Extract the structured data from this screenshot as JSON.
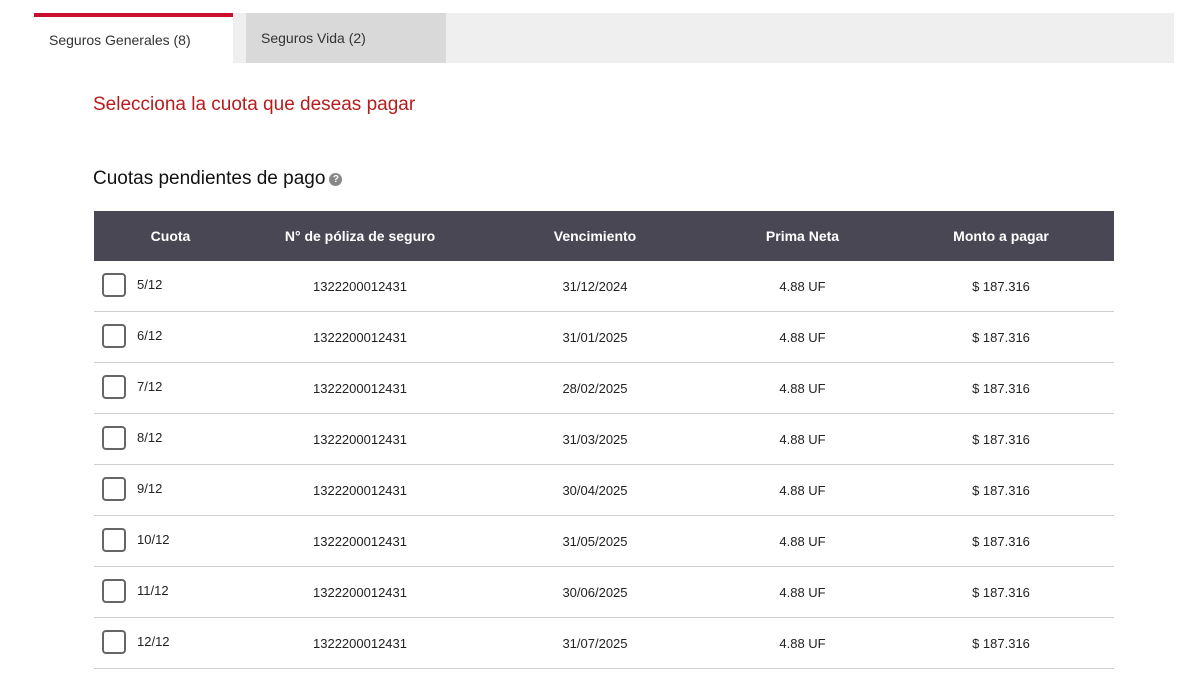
{
  "tabs": [
    {
      "label": "Seguros Generales (8)",
      "active": true
    },
    {
      "label": "Seguros Vida (2)",
      "active": false
    }
  ],
  "accent_color": "#c8102e",
  "section_title": "Selecciona la cuota que deseas pagar",
  "subtitle": "Cuotas pendientes de pago",
  "help_icon": "question-circle-icon",
  "table": {
    "headers": [
      "Cuota",
      "N° de póliza de seguro",
      "Vencimiento",
      "Prima Neta",
      "Monto a pagar"
    ],
    "rows": [
      {
        "cuota": "5/12",
        "poliza": "1322200012431",
        "vencimiento": "31/12/2024",
        "prima": "4.88 UF",
        "monto": "$ 187.316",
        "checked": false
      },
      {
        "cuota": "6/12",
        "poliza": "1322200012431",
        "vencimiento": "31/01/2025",
        "prima": "4.88 UF",
        "monto": "$ 187.316",
        "checked": false
      },
      {
        "cuota": "7/12",
        "poliza": "1322200012431",
        "vencimiento": "28/02/2025",
        "prima": "4.88 UF",
        "monto": "$ 187.316",
        "checked": false
      },
      {
        "cuota": "8/12",
        "poliza": "1322200012431",
        "vencimiento": "31/03/2025",
        "prima": "4.88 UF",
        "monto": "$ 187.316",
        "checked": false
      },
      {
        "cuota": "9/12",
        "poliza": "1322200012431",
        "vencimiento": "30/04/2025",
        "prima": "4.88 UF",
        "monto": "$ 187.316",
        "checked": false
      },
      {
        "cuota": "10/12",
        "poliza": "1322200012431",
        "vencimiento": "31/05/2025",
        "prima": "4.88 UF",
        "monto": "$ 187.316",
        "checked": false
      },
      {
        "cuota": "11/12",
        "poliza": "1322200012431",
        "vencimiento": "30/06/2025",
        "prima": "4.88 UF",
        "monto": "$ 187.316",
        "checked": false
      },
      {
        "cuota": "12/12",
        "poliza": "1322200012431",
        "vencimiento": "31/07/2025",
        "prima": "4.88 UF",
        "monto": "$ 187.316",
        "checked": false
      }
    ]
  }
}
